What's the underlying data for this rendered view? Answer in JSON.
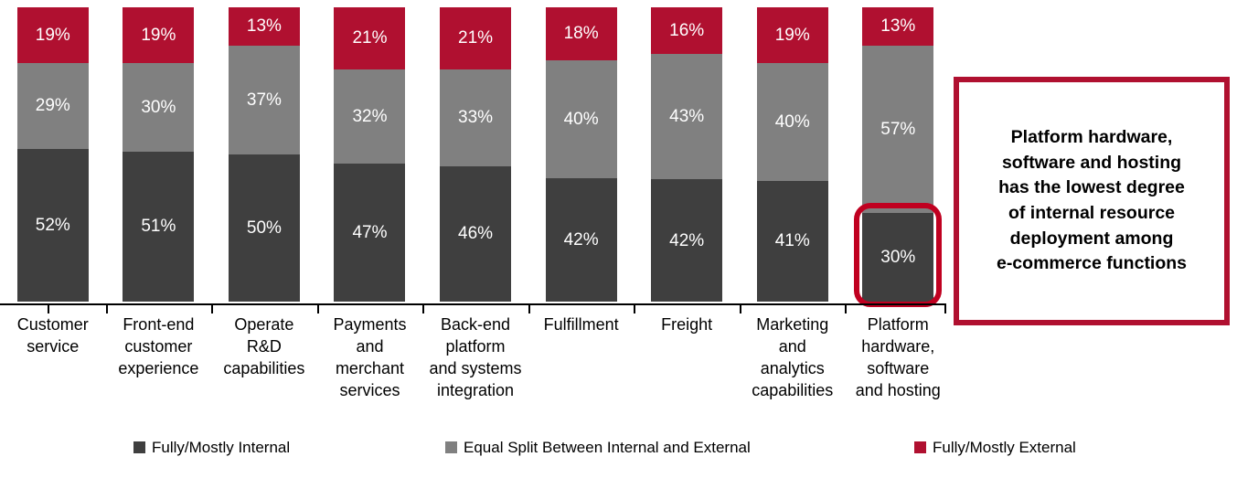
{
  "chart_data": {
    "type": "bar",
    "title": "",
    "subtitle": "",
    "xlabel": "",
    "ylabel": "",
    "ylim": [
      0,
      100
    ],
    "stacked": true,
    "normalized_percent": true,
    "grid": false,
    "legend_position": "bottom",
    "value_suffix": "%",
    "categories": [
      "Customer service",
      "Front-end customer experience",
      "Operate R&D capabilities",
      "Payments and merchant services",
      "Back-end platform and systems integration",
      "Fulfillment",
      "Freight",
      "Marketing and analytics capabilities",
      "Platform hardware, software and hosting"
    ],
    "category_label_lines": [
      [
        "Customer",
        "service"
      ],
      [
        "Front-end",
        "customer",
        "experience"
      ],
      [
        "Operate",
        "R&D",
        "capabilities"
      ],
      [
        "Payments",
        "and",
        "merchant",
        "services"
      ],
      [
        "Back-end",
        "platform",
        "and systems",
        "integration"
      ],
      [
        "Fulfillment"
      ],
      [
        "Freight"
      ],
      [
        "Marketing",
        "and",
        "analytics",
        "capabilities"
      ],
      [
        "Platform",
        "hardware,",
        "software",
        "and hosting"
      ]
    ],
    "series": [
      {
        "name": "Fully/Mostly Internal",
        "color": "#3f3f3f",
        "values": [
          52,
          51,
          50,
          47,
          46,
          42,
          42,
          41,
          30
        ],
        "labels": [
          "52%",
          "51%",
          "50%",
          "47%",
          "46%",
          "42%",
          "42%",
          "41%",
          "30%"
        ]
      },
      {
        "name": "Equal Split Between Internal and External",
        "color": "#808080",
        "values": [
          29,
          30,
          37,
          32,
          33,
          40,
          43,
          40,
          57
        ],
        "labels": [
          "29%",
          "30%",
          "37%",
          "32%",
          "33%",
          "40%",
          "43%",
          "40%",
          "57%"
        ]
      },
      {
        "name": "Fully/Mostly External",
        "color": "#b01030",
        "values": [
          19,
          19,
          13,
          21,
          21,
          18,
          16,
          19,
          13
        ],
        "labels": [
          "19%",
          "19%",
          "13%",
          "21%",
          "21%",
          "18%",
          "16%",
          "19%",
          "13%"
        ]
      }
    ],
    "annotations": [
      {
        "type": "highlight-rect",
        "target_category": "Platform hardware, software and hosting",
        "target_series": "Fully/Mostly Internal",
        "color": "#c00020"
      },
      {
        "type": "callout-box",
        "text": "Platform hardware, software and hosting has the lowest degree of internal resource deployment among e-commerce functions",
        "border_color": "#b01030"
      }
    ]
  },
  "legend": {
    "items": [
      {
        "label": "Fully/Mostly Internal",
        "color": "#3f3f3f"
      },
      {
        "label": "Equal Split Between Internal and External",
        "color": "#808080"
      },
      {
        "label": "Fully/Mostly External",
        "color": "#b01030"
      }
    ]
  },
  "callout": {
    "lines": [
      "Platform hardware,",
      "software and hosting",
      "has the lowest degree",
      "of internal resource",
      "deployment among",
      "e-commerce functions"
    ]
  }
}
